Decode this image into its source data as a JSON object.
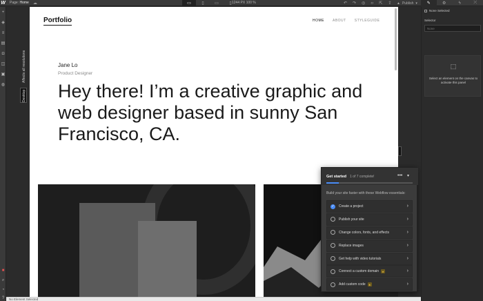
{
  "topbar": {
    "logo": "W",
    "page_prefix": "Page:",
    "page_name": "Home",
    "dims": "1244 PX  100 %",
    "publish": "Publish"
  },
  "breakpoint": {
    "note": "Affects all resolutions",
    "name": "Desktop"
  },
  "site": {
    "logo": "Portfolio",
    "nav": [
      "HOME",
      "ABOUT",
      "STYLEGUIDE"
    ],
    "name": "Jane Lo",
    "role": "Product Designer",
    "headline": "Hey there! I’m a creative graphic and web designer based in sunny San Francisco, CA."
  },
  "get_started": {
    "title": "Get started",
    "count": "1 of 7 complete!",
    "progress": 0.143,
    "intro": "Build your site faster with these Webflow essentials:",
    "items": [
      {
        "label": "Create a project",
        "done": true,
        "star": false
      },
      {
        "label": "Publish your site",
        "done": false,
        "star": false
      },
      {
        "label": "Change colors, fonts, and effects",
        "done": false,
        "star": false
      },
      {
        "label": "Replace images",
        "done": false,
        "star": false
      },
      {
        "label": "Get help with video tutorials",
        "done": false,
        "star": false
      },
      {
        "label": "Connect a custom domain",
        "done": false,
        "star": true
      },
      {
        "label": "Add custom code",
        "done": false,
        "star": true
      }
    ]
  },
  "right_panel": {
    "none_selected": "None Selected",
    "selector_label": "Selector",
    "selector_placeholder": "None",
    "hint": "Select an element on the canvas to activate this panel"
  },
  "statusbar": {
    "text": "No Element Selected"
  },
  "colors": {
    "accent": "#4a8df8",
    "chrome": "#2b2b2b",
    "canvas": "#ffffff"
  }
}
